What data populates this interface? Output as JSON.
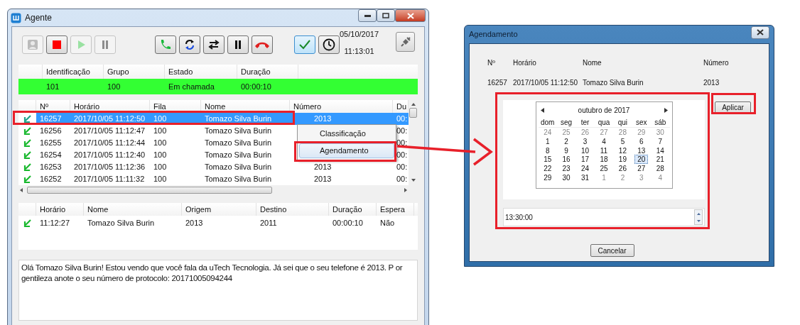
{
  "agent_window": {
    "title": "Agente",
    "toolbar_groups": [
      [
        {
          "kind": "user",
          "disabled": true
        },
        {
          "kind": "stop",
          "disabled": false
        },
        {
          "kind": "play",
          "disabled": true
        },
        {
          "kind": "pause",
          "disabled": true
        }
      ],
      [
        {
          "kind": "phone",
          "disabled": false
        },
        {
          "kind": "sync",
          "disabled": false
        },
        {
          "kind": "swap",
          "disabled": false
        },
        {
          "kind": "pause",
          "disabled": false
        },
        {
          "kind": "hangup",
          "disabled": false
        }
      ],
      [
        {
          "kind": "check",
          "disabled": false,
          "selected": true
        },
        {
          "kind": "clock",
          "disabled": false,
          "selected": false
        }
      ]
    ],
    "date": "05/10/2017",
    "time": "11:13:01",
    "agent_table": {
      "columns": [
        "Identificação",
        "Grupo",
        "Estado",
        "Duração"
      ],
      "rows": [
        {
          "color": "#33ff33",
          "cells": [
            "101",
            "100",
            "Em chamada",
            "00:00:10"
          ]
        }
      ]
    },
    "calls_table": {
      "columns": [
        "Nº",
        "Horário",
        "Fila",
        "Nome",
        "Número",
        "Du"
      ],
      "rows": [
        {
          "selected": true,
          "cells": [
            "16257",
            "2017/10/05 11:12:50",
            "100",
            "Tomazo Silva Burin",
            "2013",
            "00:"
          ]
        },
        {
          "selected": false,
          "cells": [
            "16256",
            "2017/10/05 11:12:47",
            "100",
            "Tomazo Silva Burin",
            null,
            "00:"
          ]
        },
        {
          "selected": false,
          "cells": [
            "16255",
            "2017/10/05 11:12:44",
            "100",
            "Tomazo Silva Burin",
            null,
            "00:"
          ]
        },
        {
          "selected": false,
          "cells": [
            "16254",
            "2017/10/05 11:12:40",
            "100",
            "Tomazo Silva Burin",
            null,
            "00:"
          ]
        },
        {
          "selected": false,
          "cells": [
            "16253",
            "2017/10/05 11:12:36",
            "100",
            "Tomazo Silva Burin",
            "2013",
            "00:"
          ]
        },
        {
          "selected": false,
          "cells": [
            "16252",
            "2017/10/05 11:11:32",
            "100",
            "Tomazo Silva Burin",
            "2013",
            "00:"
          ]
        }
      ]
    },
    "context_menu": [
      {
        "label": "Classificação",
        "selected": false
      },
      {
        "label": "Agendamento",
        "selected": true
      }
    ],
    "history_table": {
      "columns": [
        "Horário",
        "Nome",
        "Origem",
        "Destino",
        "Duração",
        "Espera"
      ],
      "rows": [
        {
          "cells": [
            "11:12:27",
            "Tomazo Silva Burin",
            "2013",
            "2011",
            "00:00:10",
            "Não"
          ]
        }
      ]
    },
    "message": "Olá Tomazo Silva Burin! Estou vendo que você fala da uTech Tecnologia. Já sei que o seu telefone é 2013. P or gentileza anote o seu número de protocolo: 20171005094244"
  },
  "schedule_dialog": {
    "title": "Agendamento",
    "columns": [
      "Nº",
      "Horário",
      "Nome",
      "Número"
    ],
    "values": [
      "16257",
      "2017/10/05 11:12:50",
      "Tomazo Silva Burin",
      "2013"
    ],
    "calendar": {
      "month": "outubro de 2017",
      "weekdays": [
        "dom",
        "seg",
        "ter",
        "qua",
        "qui",
        "sex",
        "sáb"
      ],
      "days": [
        {
          "label": "24",
          "in_month": false,
          "selected": false
        },
        {
          "label": "25",
          "in_month": false,
          "selected": false
        },
        {
          "label": "26",
          "in_month": false,
          "selected": false
        },
        {
          "label": "27",
          "in_month": false,
          "selected": false
        },
        {
          "label": "28",
          "in_month": false,
          "selected": false
        },
        {
          "label": "29",
          "in_month": false,
          "selected": false
        },
        {
          "label": "30",
          "in_month": false,
          "selected": false
        },
        {
          "label": "1",
          "in_month": true,
          "selected": false
        },
        {
          "label": "2",
          "in_month": true,
          "selected": false
        },
        {
          "label": "3",
          "in_month": true,
          "selected": false
        },
        {
          "label": "4",
          "in_month": true,
          "selected": false
        },
        {
          "label": "5",
          "in_month": true,
          "selected": false
        },
        {
          "label": "6",
          "in_month": true,
          "selected": false
        },
        {
          "label": "7",
          "in_month": true,
          "selected": false
        },
        {
          "label": "8",
          "in_month": true,
          "selected": false
        },
        {
          "label": "9",
          "in_month": true,
          "selected": false
        },
        {
          "label": "10",
          "in_month": true,
          "selected": false
        },
        {
          "label": "11",
          "in_month": true,
          "selected": false
        },
        {
          "label": "12",
          "in_month": true,
          "selected": false
        },
        {
          "label": "13",
          "in_month": true,
          "selected": false
        },
        {
          "label": "14",
          "in_month": true,
          "selected": false
        },
        {
          "label": "15",
          "in_month": true,
          "selected": false
        },
        {
          "label": "16",
          "in_month": true,
          "selected": false
        },
        {
          "label": "17",
          "in_month": true,
          "selected": false
        },
        {
          "label": "18",
          "in_month": true,
          "selected": false
        },
        {
          "label": "19",
          "in_month": true,
          "selected": false
        },
        {
          "label": "20",
          "in_month": true,
          "selected": true
        },
        {
          "label": "21",
          "in_month": true,
          "selected": false
        },
        {
          "label": "22",
          "in_month": true,
          "selected": false
        },
        {
          "label": "23",
          "in_month": true,
          "selected": false
        },
        {
          "label": "24",
          "in_month": true,
          "selected": false
        },
        {
          "label": "25",
          "in_month": true,
          "selected": false
        },
        {
          "label": "26",
          "in_month": true,
          "selected": false
        },
        {
          "label": "27",
          "in_month": true,
          "selected": false
        },
        {
          "label": "28",
          "in_month": true,
          "selected": false
        },
        {
          "label": "29",
          "in_month": true,
          "selected": false
        },
        {
          "label": "30",
          "in_month": true,
          "selected": false
        },
        {
          "label": "31",
          "in_month": true,
          "selected": false
        },
        {
          "label": "1",
          "in_month": false,
          "selected": false
        },
        {
          "label": "2",
          "in_month": false,
          "selected": false
        },
        {
          "label": "3",
          "in_month": false,
          "selected": false
        },
        {
          "label": "4",
          "in_month": false,
          "selected": false
        }
      ]
    },
    "time": "13:30:00",
    "buttons": {
      "apply": "Aplicar",
      "cancel": "Cancelar"
    }
  }
}
